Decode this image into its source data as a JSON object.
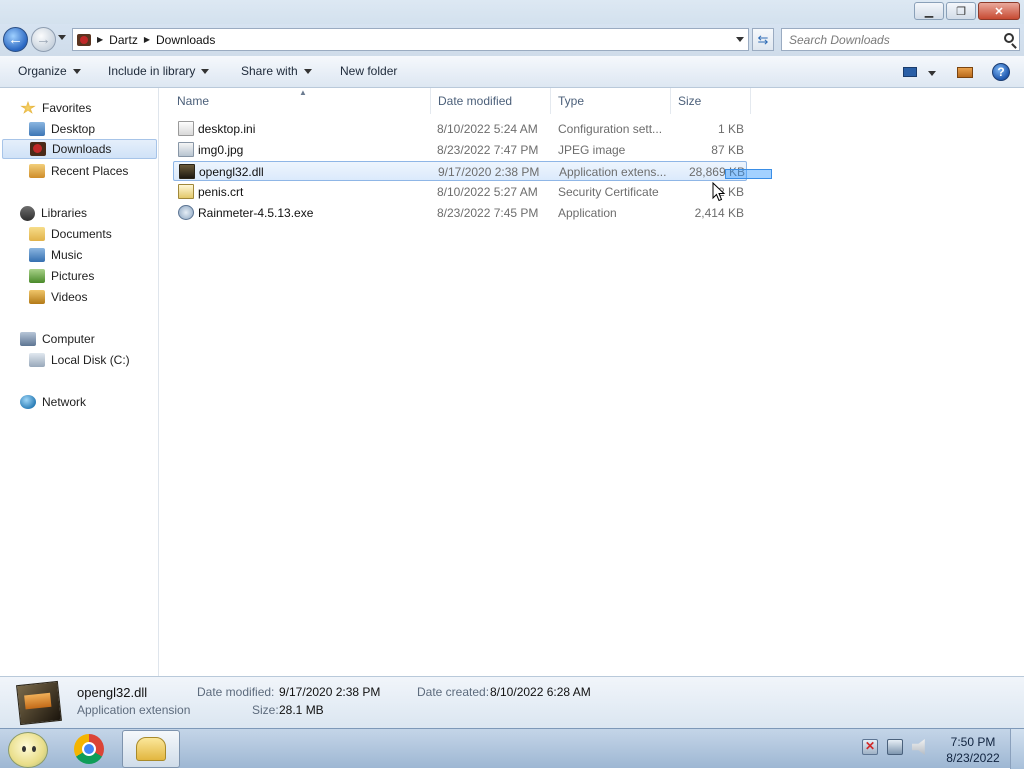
{
  "window": {
    "buttons": {
      "minimize": "▁",
      "maximize": "❐",
      "close": "✕"
    }
  },
  "address": {
    "crumbs": [
      "Dartz",
      "Downloads"
    ],
    "search_placeholder": "Search Downloads"
  },
  "toolbar": {
    "organize": "Organize",
    "include_in_library": "Include in library",
    "share_with": "Share with",
    "new_folder": "New folder"
  },
  "nav": {
    "favorites": "Favorites",
    "desktop": "Desktop",
    "downloads": "Downloads",
    "recent_places": "Recent Places",
    "libraries": "Libraries",
    "documents": "Documents",
    "music": "Music",
    "pictures": "Pictures",
    "videos": "Videos",
    "computer": "Computer",
    "local_disk": "Local Disk (C:)",
    "network": "Network"
  },
  "columns": {
    "name": "Name",
    "date": "Date modified",
    "type": "Type",
    "size": "Size"
  },
  "files": [
    {
      "name": "desktop.ini",
      "date": "8/10/2022 5:24 AM",
      "type": "Configuration sett...",
      "size": "1 KB"
    },
    {
      "name": "img0.jpg",
      "date": "8/23/2022 7:47 PM",
      "type": "JPEG image",
      "size": "87 KB"
    },
    {
      "name": "opengl32.dll",
      "date": "9/17/2020 2:38 PM",
      "type": "Application extens...",
      "size": "28,869 KB"
    },
    {
      "name": "penis.crt",
      "date": "8/10/2022 5:27 AM",
      "type": "Security Certificate",
      "size": "2 KB"
    },
    {
      "name": "Rainmeter-4.5.13.exe",
      "date": "8/23/2022 7:45 PM",
      "type": "Application",
      "size": "2,414 KB"
    }
  ],
  "details": {
    "name": "opengl32.dll",
    "kind": "Application extension",
    "modified_label": "Date modified:",
    "modified_value": "9/17/2020 2:38 PM",
    "size_label": "Size:",
    "size_value": "28.1 MB",
    "created_label": "Date created:",
    "created_value": "8/10/2022 6:28 AM"
  },
  "taskbar": {
    "time": "7:50 PM",
    "date": "8/23/2022"
  }
}
